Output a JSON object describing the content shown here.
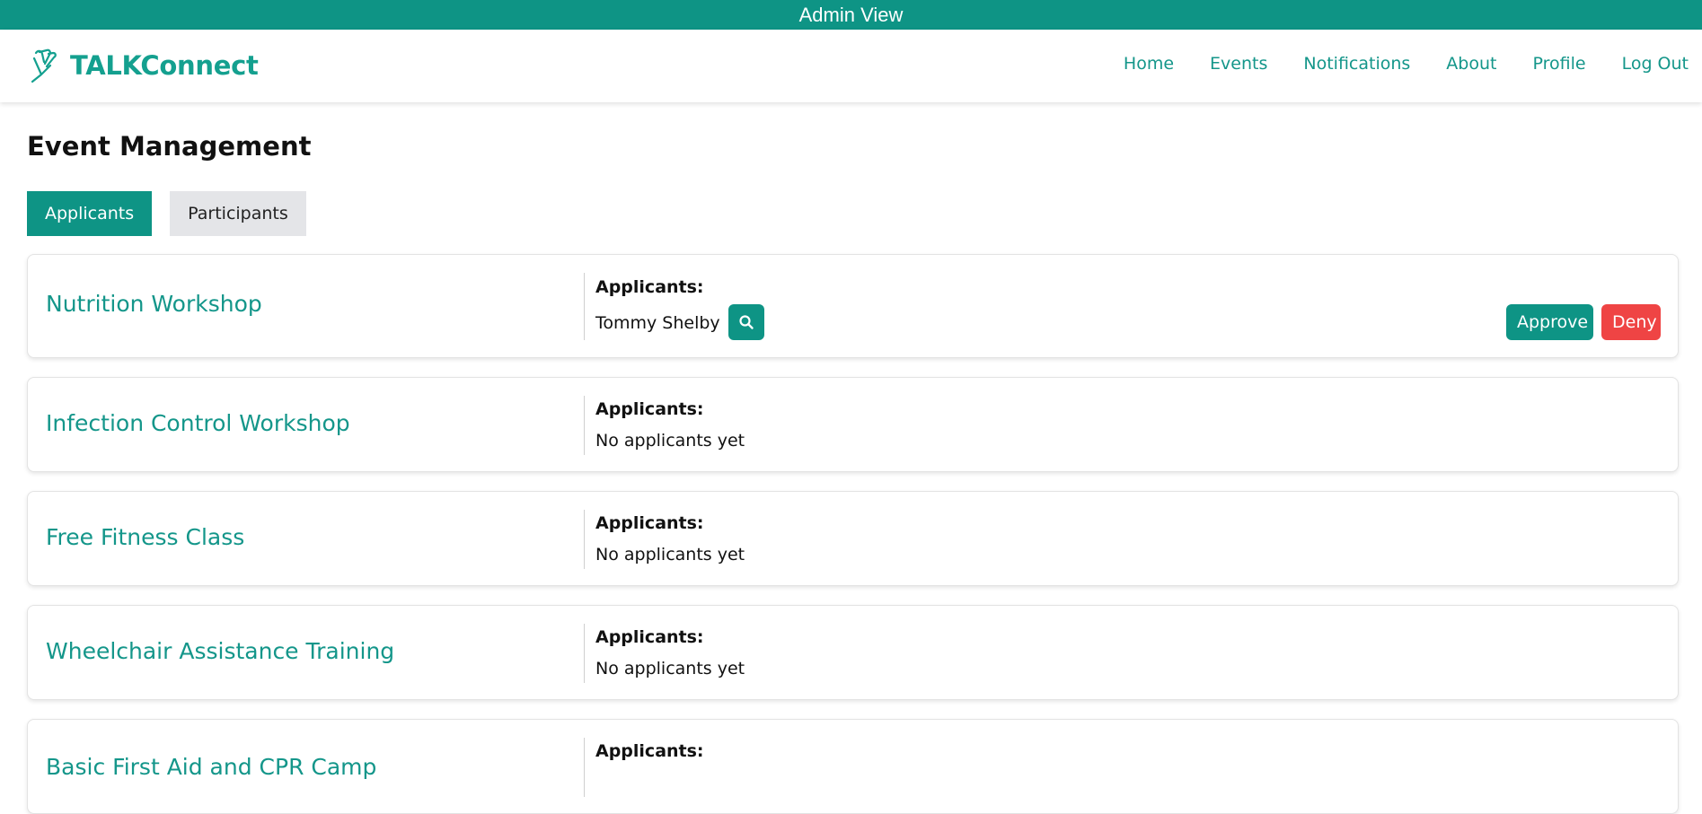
{
  "admin_bar": {
    "label": "Admin View"
  },
  "navbar": {
    "brand": "TALKConnect",
    "links": [
      "Home",
      "Events",
      "Notifications",
      "About",
      "Profile",
      "Log Out"
    ]
  },
  "page": {
    "title": "Event Management",
    "tabs": [
      "Applicants",
      "Participants"
    ],
    "active_tab": "Applicants"
  },
  "events": [
    {
      "title": "Nutrition Workshop",
      "label": "Applicants:",
      "applicant": "Tommy Shelby",
      "approve": "Approve",
      "deny": "Deny"
    },
    {
      "title": "Infection Control Workshop",
      "label": "Applicants:",
      "empty": "No applicants yet"
    },
    {
      "title": "Free Fitness Class",
      "label": "Applicants:",
      "empty": "No applicants yet"
    },
    {
      "title": "Wheelchair Assistance Training",
      "label": "Applicants:",
      "empty": "No applicants yet"
    },
    {
      "title": "Basic First Aid and CPR Camp",
      "label": "Applicants:"
    }
  ],
  "colors": {
    "primary": "#0e9485",
    "danger": "#ef4444",
    "tab_inactive": "#e4e5e8"
  },
  "icons": {
    "brand": "hand-icon",
    "search": "search-icon"
  }
}
